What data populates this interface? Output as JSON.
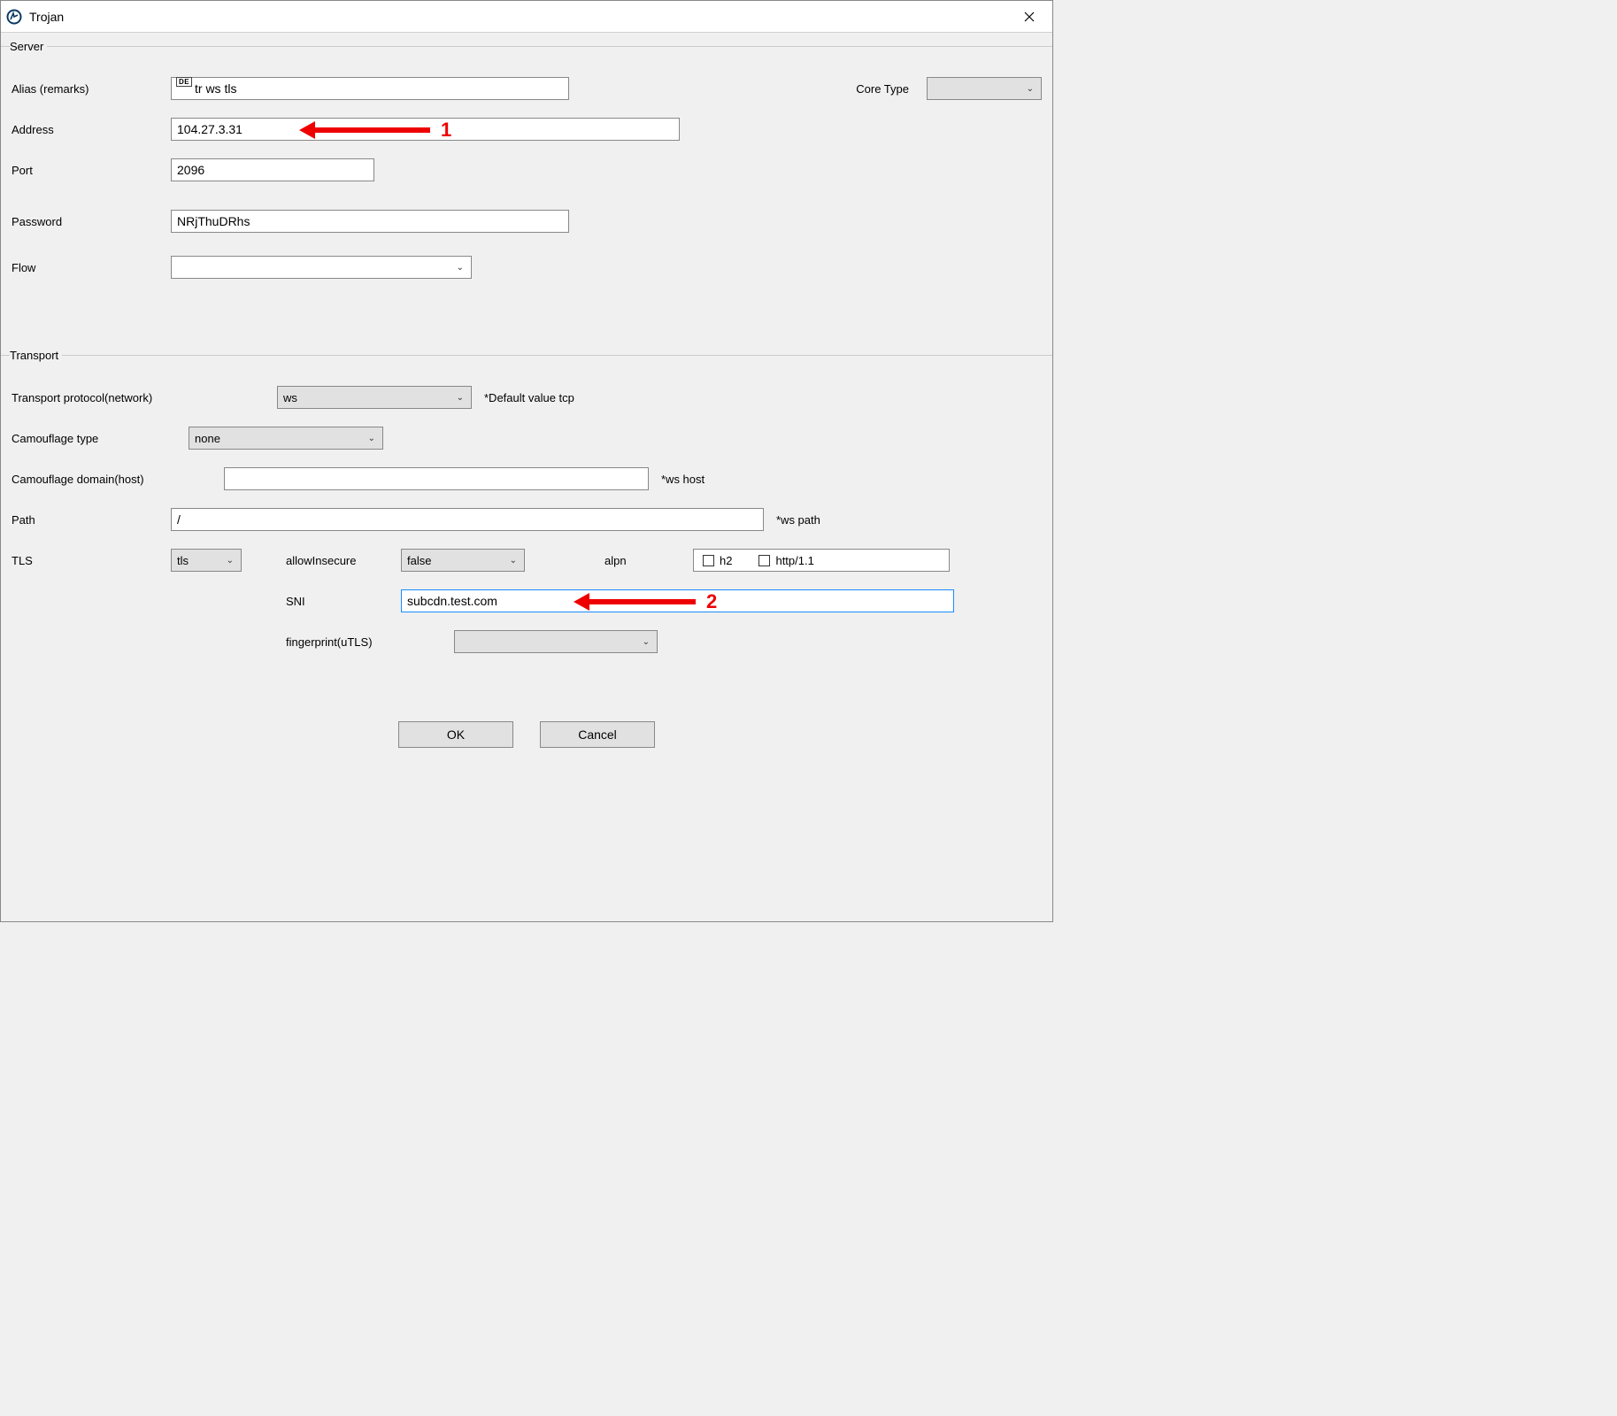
{
  "window": {
    "title": "Trojan"
  },
  "server": {
    "legend": "Server",
    "alias_label": "Alias (remarks)",
    "alias_prefix": "DE",
    "alias_value": "tr ws tls",
    "address_label": "Address",
    "address_value": "104.27.3.31",
    "port_label": "Port",
    "port_value": "2096",
    "password_label": "Password",
    "password_value": "NRjThuDRhs",
    "flow_label": "Flow",
    "flow_value": "",
    "core_type_label": "Core Type",
    "core_type_value": ""
  },
  "transport": {
    "legend": "Transport",
    "protocol_label": "Transport protocol(network)",
    "protocol_value": "ws",
    "protocol_hint": "*Default value tcp",
    "camo_type_label": "Camouflage type",
    "camo_type_value": "none",
    "camo_domain_label": "Camouflage domain(host)",
    "camo_domain_value": "",
    "camo_domain_hint": "*ws host",
    "path_label": "Path",
    "path_value": "/",
    "path_hint": "*ws path",
    "tls_label": "TLS",
    "tls_value": "tls",
    "allow_insecure_label": "allowInsecure",
    "allow_insecure_value": "false",
    "alpn_label": "alpn",
    "alpn_h2": "h2",
    "alpn_http11": "http/1.1",
    "sni_label": "SNI",
    "sni_value": "subcdn.test.com",
    "fingerprint_label": "fingerprint(uTLS)",
    "fingerprint_value": ""
  },
  "buttons": {
    "ok": "OK",
    "cancel": "Cancel"
  },
  "annotations": {
    "one": "1",
    "two": "2"
  }
}
